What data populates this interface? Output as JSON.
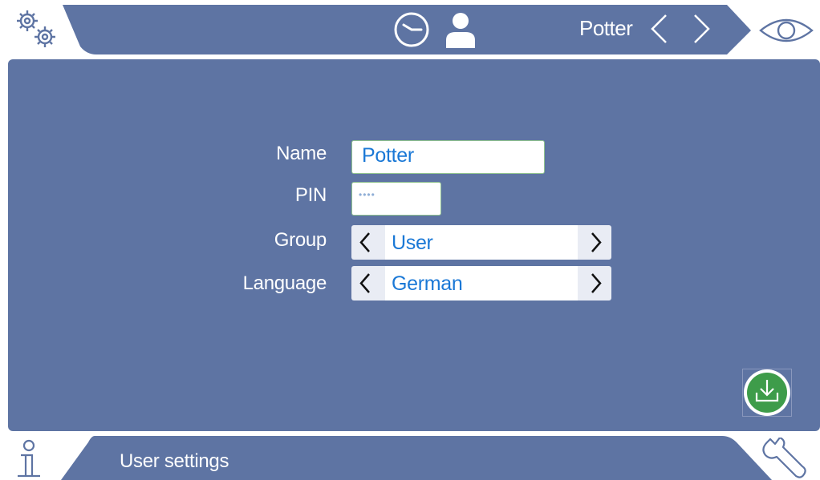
{
  "header": {
    "current_user": "Potter",
    "icons": {
      "settings": "gears-icon",
      "clock": "clock-icon",
      "user": "user-icon",
      "prev": "chevron-left-icon",
      "next": "chevron-right-icon",
      "view": "eye-icon"
    }
  },
  "form": {
    "name_label": "Name",
    "name_value": "Potter",
    "pin_label": "PIN",
    "pin_value": "••••",
    "group_label": "Group",
    "group_value": "User",
    "language_label": "Language",
    "language_value": "German"
  },
  "footer": {
    "title": "User settings",
    "icons": {
      "info": "info-icon",
      "service": "wrench-icon"
    }
  },
  "colors": {
    "panel": "#5e74a3",
    "value_text": "#1a78d6",
    "save_green": "#3e9c4a"
  }
}
